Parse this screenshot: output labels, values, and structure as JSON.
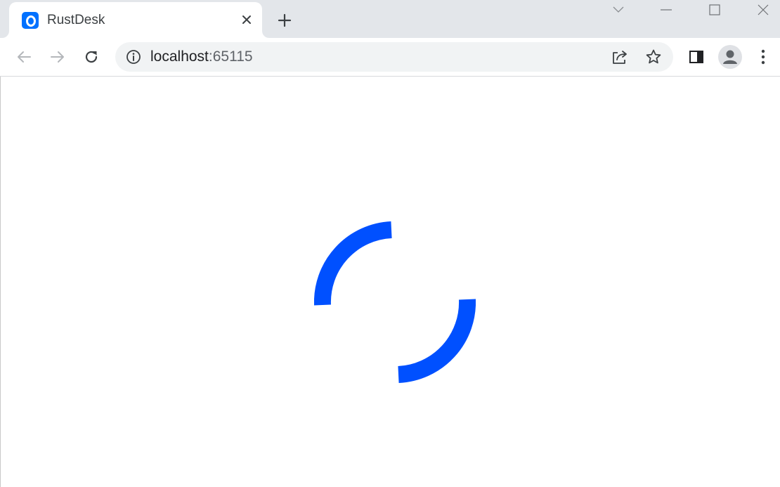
{
  "browser": {
    "tab": {
      "title": "RustDesk",
      "favicon": "rustdesk-logo-icon",
      "close_icon": "close-icon"
    },
    "new_tab_icon": "plus-icon",
    "window_controls": [
      "chevron-down-icon",
      "minimize-icon",
      "maximize-icon",
      "close-icon"
    ],
    "toolbar": {
      "back_icon": "arrow-left-icon",
      "forward_icon": "arrow-right-icon",
      "reload_icon": "reload-icon",
      "site_info_icon": "info-icon",
      "url_host": "localhost",
      "url_port": ":65115",
      "share_icon": "share-icon",
      "bookmark_icon": "star-icon",
      "side_panel_icon": "side-panel-icon",
      "profile_icon": "avatar-icon",
      "menu_icon": "kebab-menu-icon"
    }
  },
  "content": {
    "loading_indicator": "loading-spinner-icon",
    "accent_color": "#0050ff"
  },
  "colors": {
    "tabstrip_bg": "#e3e6ea",
    "omnibox_bg": "#f1f3f4",
    "favicon_bg": "#0071ff"
  }
}
